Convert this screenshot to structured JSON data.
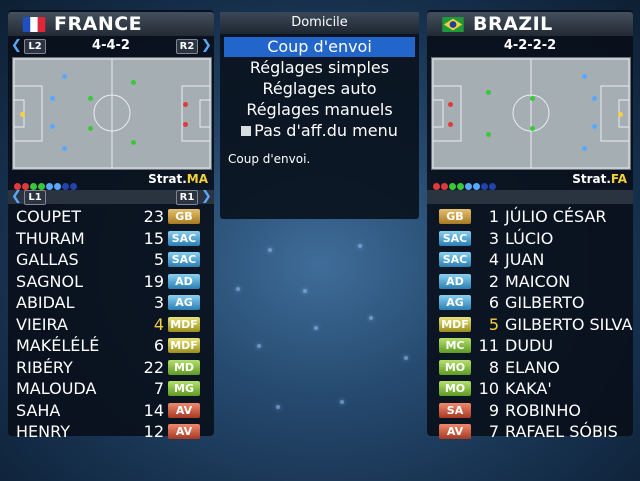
{
  "left_team": {
    "name": "FRANCE",
    "formation": "4-4-2",
    "strategy_label": "Strat.",
    "strategy_value": "MA",
    "l2": "L2",
    "r2": "R2",
    "l1": "L1",
    "r1": "R1",
    "players": [
      {
        "name": "COUPET",
        "num": "23",
        "pos": "GB",
        "cls": "b-gb"
      },
      {
        "name": "THURAM",
        "num": "15",
        "pos": "SAC",
        "cls": "b-sac"
      },
      {
        "name": "GALLAS",
        "num": "5",
        "pos": "SAC",
        "cls": "b-sac"
      },
      {
        "name": "SAGNOL",
        "num": "19",
        "pos": "AD",
        "cls": "b-sac"
      },
      {
        "name": "ABIDAL",
        "num": "3",
        "pos": "AG",
        "cls": "b-sac"
      },
      {
        "name": "VIEIRA",
        "num": "4",
        "pos": "MDF",
        "cls": "b-mdf"
      },
      {
        "name": "MAKÉLÉLÉ",
        "num": "6",
        "pos": "MDF",
        "cls": "b-mdf"
      },
      {
        "name": "RIBÉRY",
        "num": "22",
        "pos": "MD",
        "cls": "b-mc"
      },
      {
        "name": "MALOUDA",
        "num": "7",
        "pos": "MG",
        "cls": "b-mc"
      },
      {
        "name": "SAHA",
        "num": "14",
        "pos": "AV",
        "cls": "b-av"
      },
      {
        "name": "HENRY",
        "num": "12",
        "pos": "AV",
        "cls": "b-av"
      }
    ]
  },
  "right_team": {
    "name": "BRAZIL",
    "formation": "4-2-2-2",
    "strategy_label": "Strat.",
    "strategy_value": "FA",
    "players": [
      {
        "name": "JÚLIO CÉSAR",
        "num": "1",
        "pos": "GB",
        "cls": "b-gb"
      },
      {
        "name": "LÚCIO",
        "num": "3",
        "pos": "SAC",
        "cls": "b-sac"
      },
      {
        "name": "JUAN",
        "num": "4",
        "pos": "SAC",
        "cls": "b-sac"
      },
      {
        "name": "MAICON",
        "num": "2",
        "pos": "AD",
        "cls": "b-sac"
      },
      {
        "name": "GILBERTO",
        "num": "6",
        "pos": "AG",
        "cls": "b-sac"
      },
      {
        "name": "GILBERTO SILVA",
        "num": "5",
        "pos": "MDF",
        "cls": "b-mdf"
      },
      {
        "name": "DUDU",
        "num": "11",
        "pos": "MC",
        "cls": "b-mc"
      },
      {
        "name": "ELANO",
        "num": "8",
        "pos": "MO",
        "cls": "b-mc"
      },
      {
        "name": "KAKA'",
        "num": "10",
        "pos": "MO",
        "cls": "b-mc"
      },
      {
        "name": "ROBINHO",
        "num": "9",
        "pos": "SA",
        "cls": "b-av"
      },
      {
        "name": "RAFAEL SÓBIS",
        "num": "7",
        "pos": "AV",
        "cls": "b-av"
      }
    ]
  },
  "menu": {
    "title": "Domicile",
    "items": [
      "Coup d'envoi",
      "Réglages simples",
      "Réglages auto",
      "Réglages manuels",
      "Pas d'aff.du menu"
    ],
    "selected_index": 0,
    "status": "Coup d'envoi."
  }
}
